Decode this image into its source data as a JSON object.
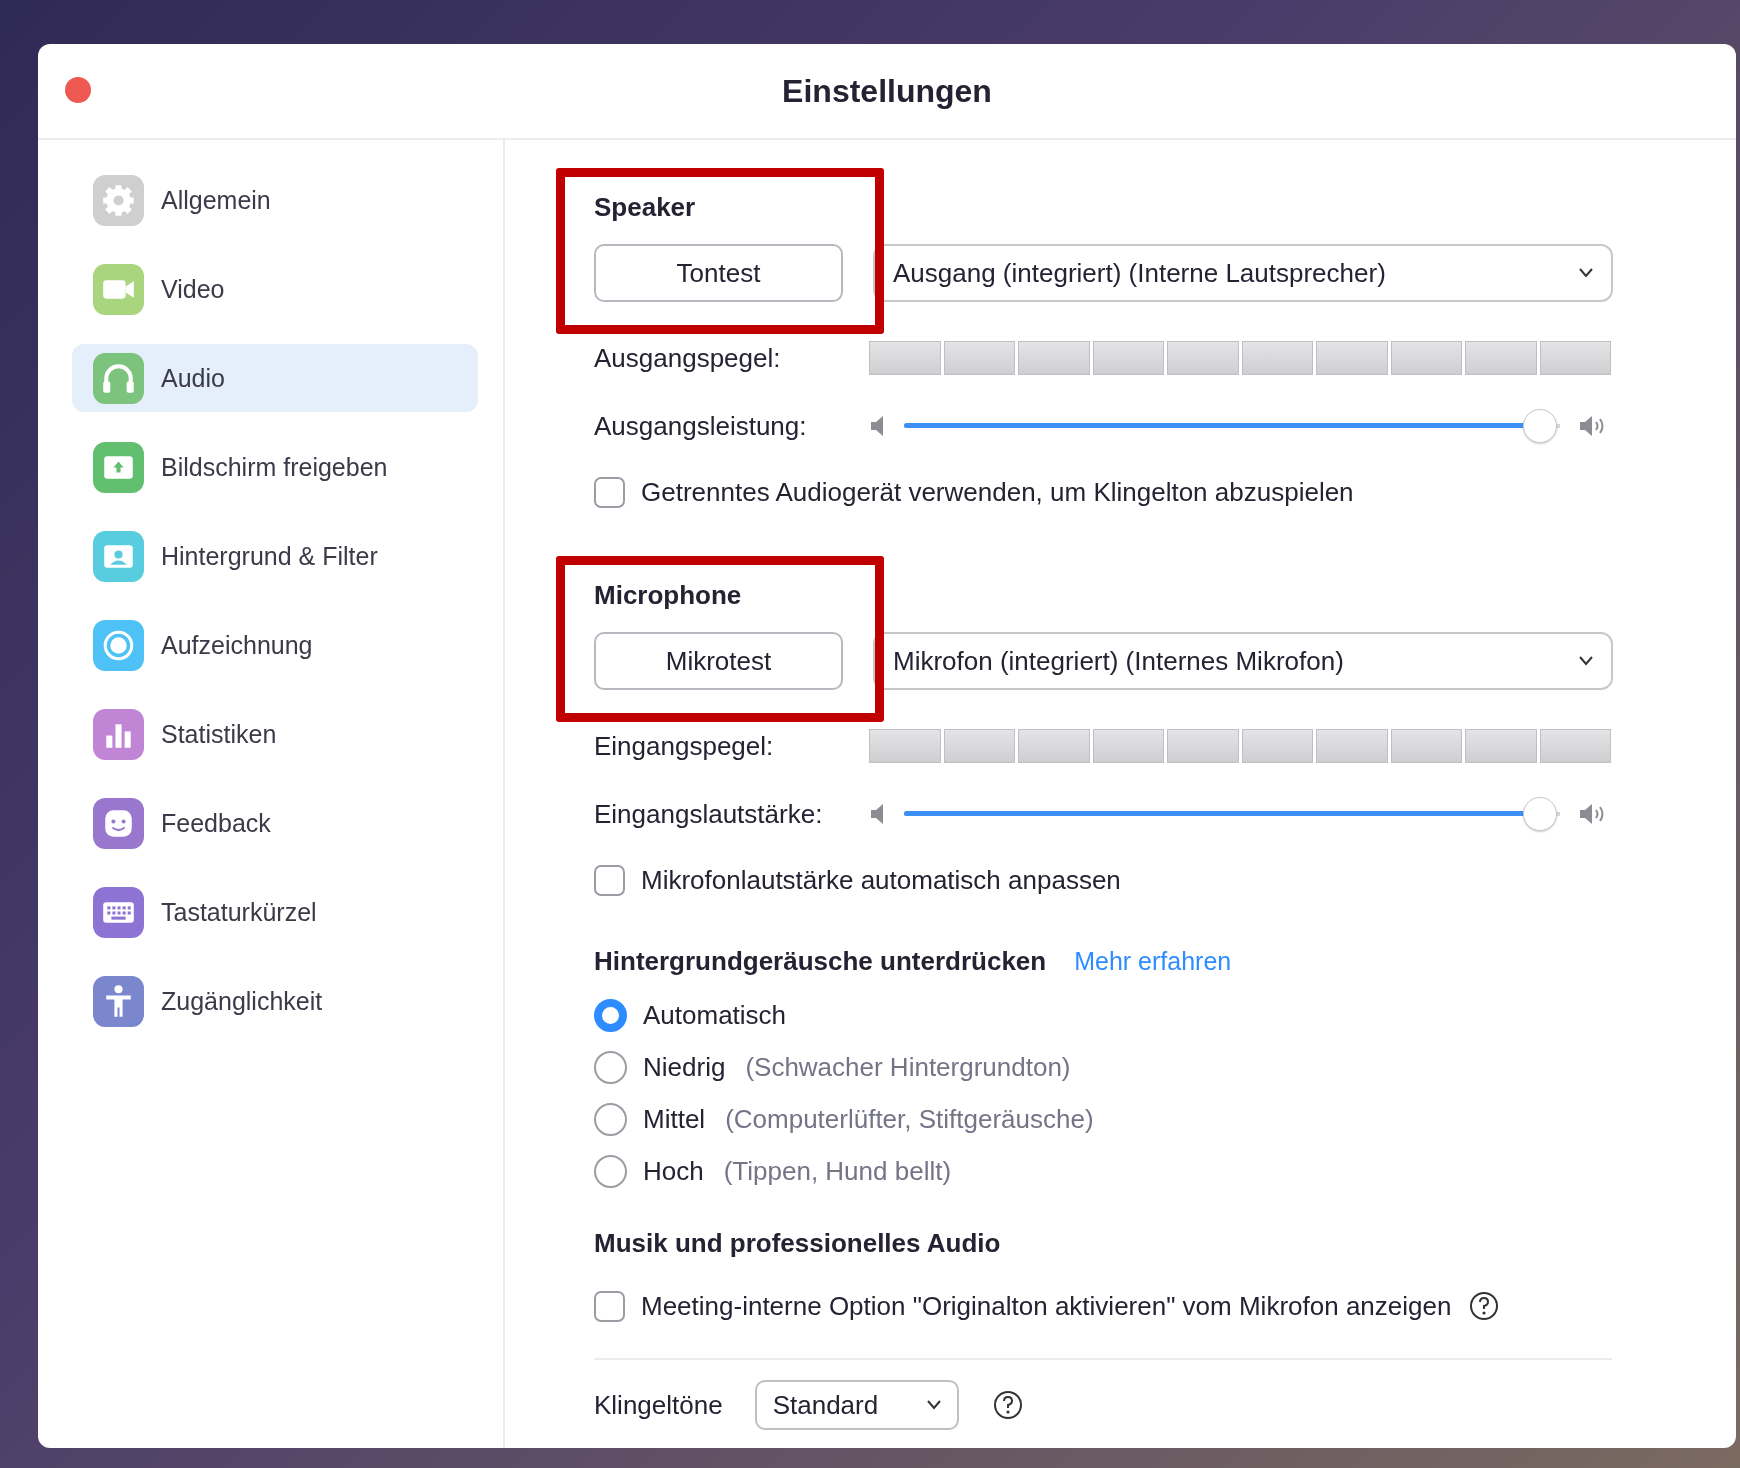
{
  "window": {
    "title": "Einstellungen"
  },
  "sidebar": {
    "items": [
      {
        "label": "Allgemein",
        "color": "#cfcfcf",
        "selected": false
      },
      {
        "label": "Video",
        "color": "#a9d57f",
        "selected": false
      },
      {
        "label": "Audio",
        "color": "#7cc47e",
        "selected": true
      },
      {
        "label": "Bildschirm freigeben",
        "color": "#62bf70",
        "selected": false
      },
      {
        "label": "Hintergrund & Filter",
        "color": "#58cde0",
        "selected": false
      },
      {
        "label": "Aufzeichnung",
        "color": "#4ec2f6",
        "selected": false
      },
      {
        "label": "Statistiken",
        "color": "#c185d5",
        "selected": false
      },
      {
        "label": "Feedback",
        "color": "#9977cf",
        "selected": false
      },
      {
        "label": "Tastaturkürzel",
        "color": "#8d74d4",
        "selected": false
      },
      {
        "label": "Zugänglichkeit",
        "color": "#7a87cc",
        "selected": false
      }
    ]
  },
  "speaker": {
    "heading": "Speaker",
    "highlighted": true,
    "test_button": "Tontest",
    "device": "Ausgang (integriert) (Interne Lautsprecher)",
    "level_label": "Ausgangspegel:",
    "volume_label": "Ausgangsleistung:",
    "volume": {
      "level": 0.97
    },
    "option": {
      "label": "Getrenntes Audiogerät verwenden, um Klingelton abzuspielen",
      "checked": false
    }
  },
  "microphone": {
    "heading": "Microphone",
    "highlighted": true,
    "test_button": "Mikrotest",
    "device": "Mikrofon (integriert) (Internes Mikrofon)",
    "level_label": "Eingangspegel:",
    "volume_label": "Eingangslautstärke:",
    "volume": {
      "level": 0.97
    },
    "option": {
      "label": "Mikrofonlautstärke automatisch anpassen",
      "checked": false
    }
  },
  "noise": {
    "heading": "Hintergrundgeräusche unterdrücken",
    "link": "Mehr erfahren",
    "options": [
      {
        "label": "Automatisch",
        "selected": true
      },
      {
        "label": "Niedrig",
        "hint": "(Schwacher Hintergrundton)",
        "selected": false
      },
      {
        "label": "Mittel",
        "hint": "(Computerlüfter, Stiftgeräusche)",
        "selected": false
      },
      {
        "label": "Hoch",
        "hint": "(Tippen, Hund bellt)",
        "selected": false
      }
    ]
  },
  "music": {
    "heading": "Musik und professionelles Audio",
    "option": {
      "label": "Meeting-interne Option \"Originalton aktivieren\" vom Mikrofon anzeigen",
      "checked": false
    }
  },
  "ringtone": {
    "label": "Klingeltöne",
    "value": "Standard"
  }
}
